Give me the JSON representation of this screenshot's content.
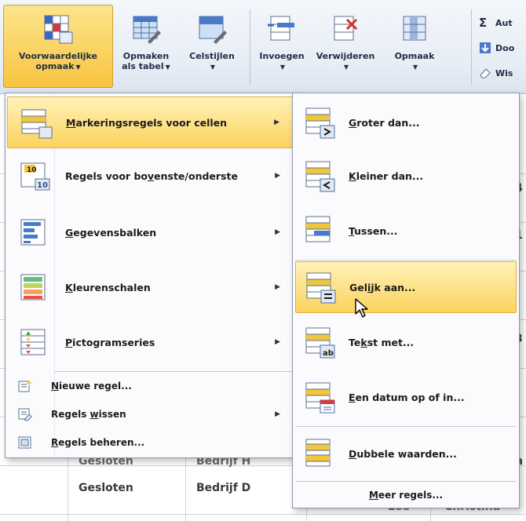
{
  "ribbon": {
    "buttons": [
      {
        "line1": "Voorwaardelijke",
        "line2": "opmaak"
      },
      {
        "line1": "Opmaken",
        "line2": "als tabel"
      },
      {
        "line1": "Celstijlen",
        "line2": ""
      },
      {
        "line1": "Invoegen",
        "line2": ""
      },
      {
        "line1": "Verwijderen",
        "line2": ""
      },
      {
        "line1": "Opmaak",
        "line2": ""
      }
    ],
    "small": [
      {
        "label": "Aut"
      },
      {
        "label": "Doo"
      },
      {
        "label": "Wis"
      }
    ]
  },
  "sheet": {
    "row_bottom": {
      "status": "Gesloten",
      "company": "Bedrijf D",
      "name": "Lee",
      "first": "Christina"
    },
    "row_partial": {
      "status": "Gesloten",
      "company": "Bedrijf H"
    },
    "edge_chars": [
      "4",
      "1",
      "3",
      "n"
    ]
  },
  "main_menu": {
    "items": [
      {
        "label": "Markeringsregels voor cellen",
        "accent_char": "M",
        "rest": "arkeringsregels voor cellen"
      },
      {
        "label": "Regels voor bovenste/onderste",
        "pre": "Regels voor bo",
        "accent_char": "v",
        "rest": "enste/onderste"
      },
      {
        "label": "Gegevensbalken",
        "accent_char": "G",
        "rest": "egevensbalken"
      },
      {
        "label": "Kleurenschalen",
        "accent_char": "K",
        "rest": "leurenschalen"
      },
      {
        "label": "Pictogramseries",
        "accent_char": "P",
        "rest": "ictogramseries"
      }
    ],
    "small_items": [
      {
        "pre": "",
        "accent_char": "N",
        "rest": "ieuwe regel..."
      },
      {
        "pre": "Regels ",
        "accent_char": "w",
        "rest": "issen"
      },
      {
        "pre": "",
        "accent_char": "R",
        "rest": "egels beheren..."
      }
    ]
  },
  "sub_menu": {
    "items": [
      {
        "accent_char": "G",
        "rest": "roter dan..."
      },
      {
        "accent_char": "K",
        "rest": "leiner dan..."
      },
      {
        "accent_char": "T",
        "rest": "ussen..."
      },
      {
        "pre": "Gel",
        "accent_char": "i",
        "rest": "jk aan..."
      },
      {
        "pre": "Te",
        "accent_char": "k",
        "rest": "st met..."
      },
      {
        "accent_char": "E",
        "rest": "en datum op of in..."
      },
      {
        "accent_char": "D",
        "rest": "ubbele waarden..."
      }
    ],
    "more": {
      "accent_char": "M",
      "rest": "eer regels..."
    }
  },
  "colors": {
    "highlight": "#fbd35e",
    "ribbon_active": "#f7c441"
  }
}
